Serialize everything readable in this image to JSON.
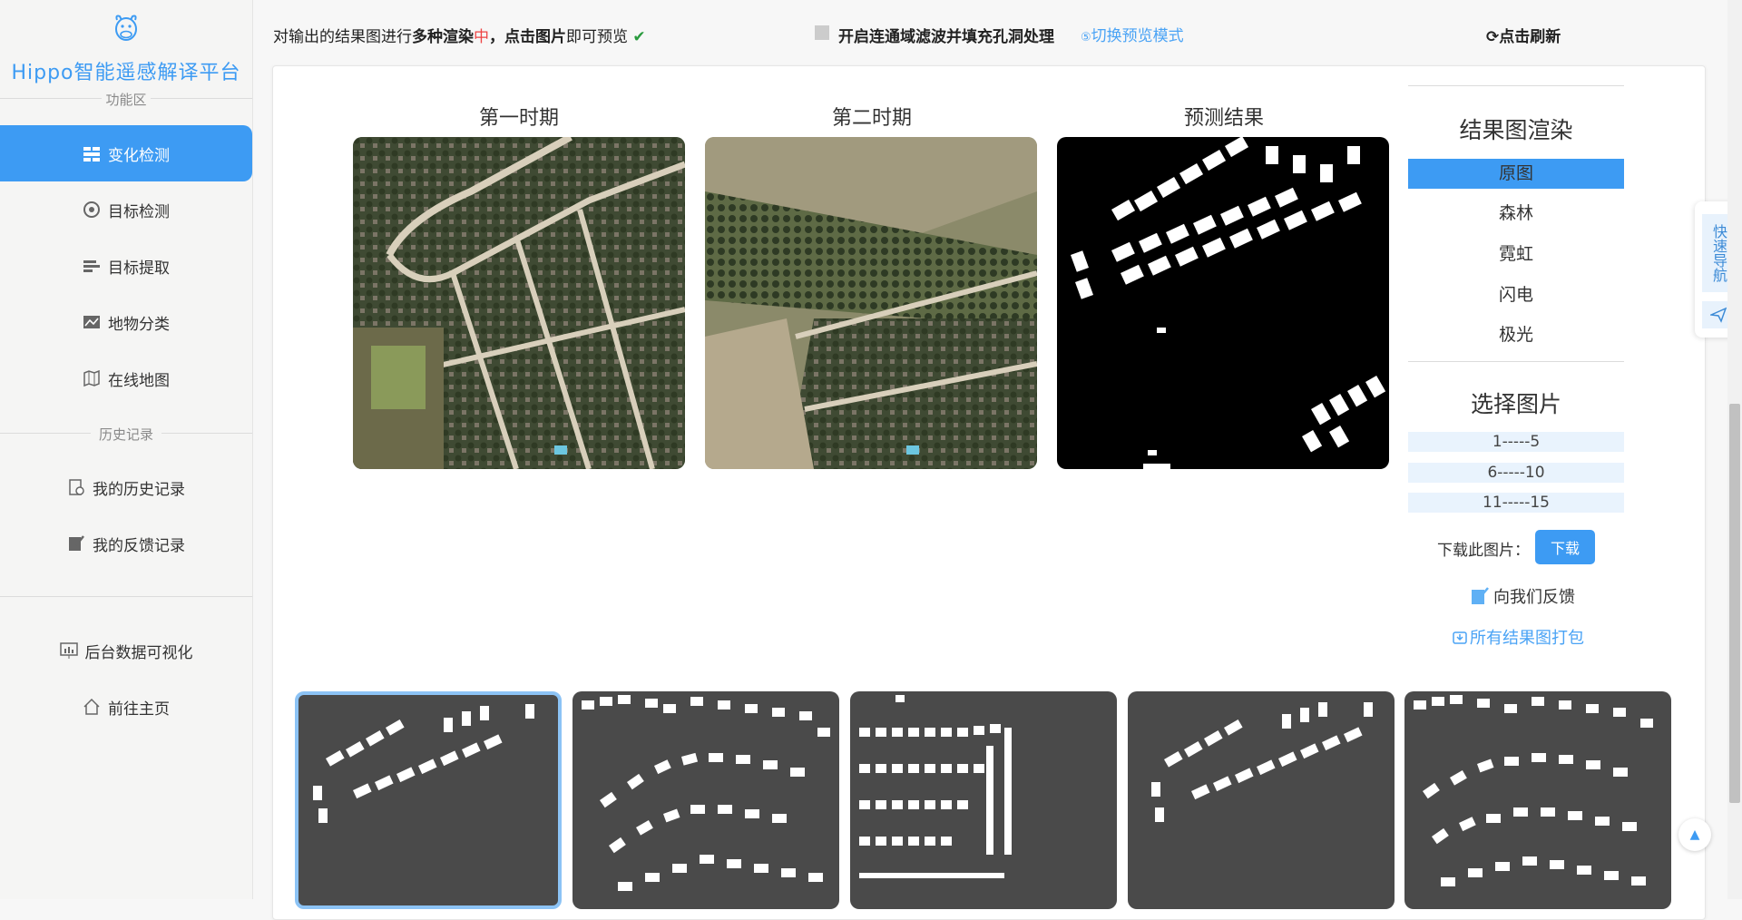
{
  "sidebar": {
    "brand": "Hippo智能遥感解译平台",
    "function_area_label": "功能区",
    "history_label": "历史记录",
    "items": [
      {
        "label": "变化检测",
        "icon": "change-detect-icon",
        "active": true
      },
      {
        "label": "目标检测",
        "icon": "target-detect-icon"
      },
      {
        "label": "目标提取",
        "icon": "target-extract-icon"
      },
      {
        "label": "地物分类",
        "icon": "land-class-icon"
      },
      {
        "label": "在线地图",
        "icon": "map-icon"
      }
    ],
    "history_items": [
      {
        "label": "我的历史记录",
        "icon": "history-icon"
      },
      {
        "label": "我的反馈记录",
        "icon": "edit-icon"
      }
    ],
    "bottom_items": [
      {
        "label": "后台数据可视化",
        "icon": "dashboard-icon"
      },
      {
        "label": "前往主页",
        "icon": "home-icon"
      }
    ]
  },
  "topbar": {
    "note_prefix": "对输出的结果图进行",
    "note_bold1": "多种渲染",
    "note_red": "中",
    "note_comma": "，",
    "note_bold2": "点击图片",
    "note_suffix": "即可预览",
    "note_check": "✔",
    "toggle_label": "开启连通域滤波并填充孔洞处理",
    "switch_link": "切换预览模式",
    "refresh_label": "点击刷新"
  },
  "main": {
    "titles": [
      "第一时期",
      "第二时期",
      "预测结果"
    ]
  },
  "controls": {
    "render_title": "结果图渲染",
    "render_options": [
      "原图",
      "森林",
      "霓虹",
      "闪电",
      "极光"
    ],
    "render_selected": "原图",
    "select_title": "选择图片",
    "ranges": [
      "1-----5",
      "6-----10",
      "11-----15"
    ],
    "download_label": "下载此图片：",
    "download_button": "下载",
    "feedback_label": "向我们反馈",
    "pack_label": "所有结果图打包"
  },
  "floating": {
    "quick_nav": "快速导航"
  },
  "colors": {
    "accent": "#3d9bf3",
    "link": "#4aa3f5",
    "thumb_bg": "#4a4a4a"
  }
}
